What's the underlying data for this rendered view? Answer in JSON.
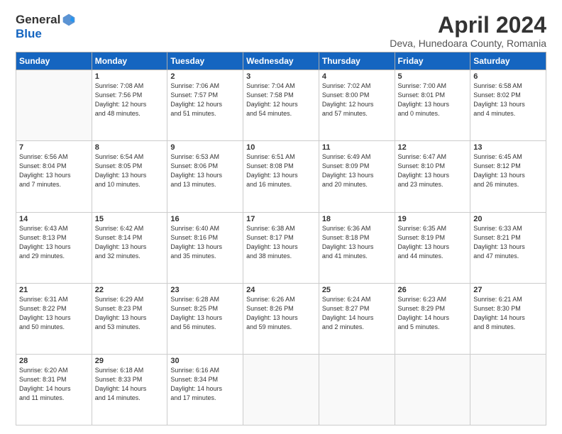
{
  "app": {
    "logo_general": "General",
    "logo_blue": "Blue"
  },
  "header": {
    "title": "April 2024",
    "subtitle": "Deva, Hunedoara County, Romania"
  },
  "calendar": {
    "weekdays": [
      "Sunday",
      "Monday",
      "Tuesday",
      "Wednesday",
      "Thursday",
      "Friday",
      "Saturday"
    ],
    "weeks": [
      [
        {
          "day": "",
          "info": ""
        },
        {
          "day": "1",
          "info": "Sunrise: 7:08 AM\nSunset: 7:56 PM\nDaylight: 12 hours\nand 48 minutes."
        },
        {
          "day": "2",
          "info": "Sunrise: 7:06 AM\nSunset: 7:57 PM\nDaylight: 12 hours\nand 51 minutes."
        },
        {
          "day": "3",
          "info": "Sunrise: 7:04 AM\nSunset: 7:58 PM\nDaylight: 12 hours\nand 54 minutes."
        },
        {
          "day": "4",
          "info": "Sunrise: 7:02 AM\nSunset: 8:00 PM\nDaylight: 12 hours\nand 57 minutes."
        },
        {
          "day": "5",
          "info": "Sunrise: 7:00 AM\nSunset: 8:01 PM\nDaylight: 13 hours\nand 0 minutes."
        },
        {
          "day": "6",
          "info": "Sunrise: 6:58 AM\nSunset: 8:02 PM\nDaylight: 13 hours\nand 4 minutes."
        }
      ],
      [
        {
          "day": "7",
          "info": "Sunrise: 6:56 AM\nSunset: 8:04 PM\nDaylight: 13 hours\nand 7 minutes."
        },
        {
          "day": "8",
          "info": "Sunrise: 6:54 AM\nSunset: 8:05 PM\nDaylight: 13 hours\nand 10 minutes."
        },
        {
          "day": "9",
          "info": "Sunrise: 6:53 AM\nSunset: 8:06 PM\nDaylight: 13 hours\nand 13 minutes."
        },
        {
          "day": "10",
          "info": "Sunrise: 6:51 AM\nSunset: 8:08 PM\nDaylight: 13 hours\nand 16 minutes."
        },
        {
          "day": "11",
          "info": "Sunrise: 6:49 AM\nSunset: 8:09 PM\nDaylight: 13 hours\nand 20 minutes."
        },
        {
          "day": "12",
          "info": "Sunrise: 6:47 AM\nSunset: 8:10 PM\nDaylight: 13 hours\nand 23 minutes."
        },
        {
          "day": "13",
          "info": "Sunrise: 6:45 AM\nSunset: 8:12 PM\nDaylight: 13 hours\nand 26 minutes."
        }
      ],
      [
        {
          "day": "14",
          "info": "Sunrise: 6:43 AM\nSunset: 8:13 PM\nDaylight: 13 hours\nand 29 minutes."
        },
        {
          "day": "15",
          "info": "Sunrise: 6:42 AM\nSunset: 8:14 PM\nDaylight: 13 hours\nand 32 minutes."
        },
        {
          "day": "16",
          "info": "Sunrise: 6:40 AM\nSunset: 8:16 PM\nDaylight: 13 hours\nand 35 minutes."
        },
        {
          "day": "17",
          "info": "Sunrise: 6:38 AM\nSunset: 8:17 PM\nDaylight: 13 hours\nand 38 minutes."
        },
        {
          "day": "18",
          "info": "Sunrise: 6:36 AM\nSunset: 8:18 PM\nDaylight: 13 hours\nand 41 minutes."
        },
        {
          "day": "19",
          "info": "Sunrise: 6:35 AM\nSunset: 8:19 PM\nDaylight: 13 hours\nand 44 minutes."
        },
        {
          "day": "20",
          "info": "Sunrise: 6:33 AM\nSunset: 8:21 PM\nDaylight: 13 hours\nand 47 minutes."
        }
      ],
      [
        {
          "day": "21",
          "info": "Sunrise: 6:31 AM\nSunset: 8:22 PM\nDaylight: 13 hours\nand 50 minutes."
        },
        {
          "day": "22",
          "info": "Sunrise: 6:29 AM\nSunset: 8:23 PM\nDaylight: 13 hours\nand 53 minutes."
        },
        {
          "day": "23",
          "info": "Sunrise: 6:28 AM\nSunset: 8:25 PM\nDaylight: 13 hours\nand 56 minutes."
        },
        {
          "day": "24",
          "info": "Sunrise: 6:26 AM\nSunset: 8:26 PM\nDaylight: 13 hours\nand 59 minutes."
        },
        {
          "day": "25",
          "info": "Sunrise: 6:24 AM\nSunset: 8:27 PM\nDaylight: 14 hours\nand 2 minutes."
        },
        {
          "day": "26",
          "info": "Sunrise: 6:23 AM\nSunset: 8:29 PM\nDaylight: 14 hours\nand 5 minutes."
        },
        {
          "day": "27",
          "info": "Sunrise: 6:21 AM\nSunset: 8:30 PM\nDaylight: 14 hours\nand 8 minutes."
        }
      ],
      [
        {
          "day": "28",
          "info": "Sunrise: 6:20 AM\nSunset: 8:31 PM\nDaylight: 14 hours\nand 11 minutes."
        },
        {
          "day": "29",
          "info": "Sunrise: 6:18 AM\nSunset: 8:33 PM\nDaylight: 14 hours\nand 14 minutes."
        },
        {
          "day": "30",
          "info": "Sunrise: 6:16 AM\nSunset: 8:34 PM\nDaylight: 14 hours\nand 17 minutes."
        },
        {
          "day": "",
          "info": ""
        },
        {
          "day": "",
          "info": ""
        },
        {
          "day": "",
          "info": ""
        },
        {
          "day": "",
          "info": ""
        }
      ]
    ]
  }
}
